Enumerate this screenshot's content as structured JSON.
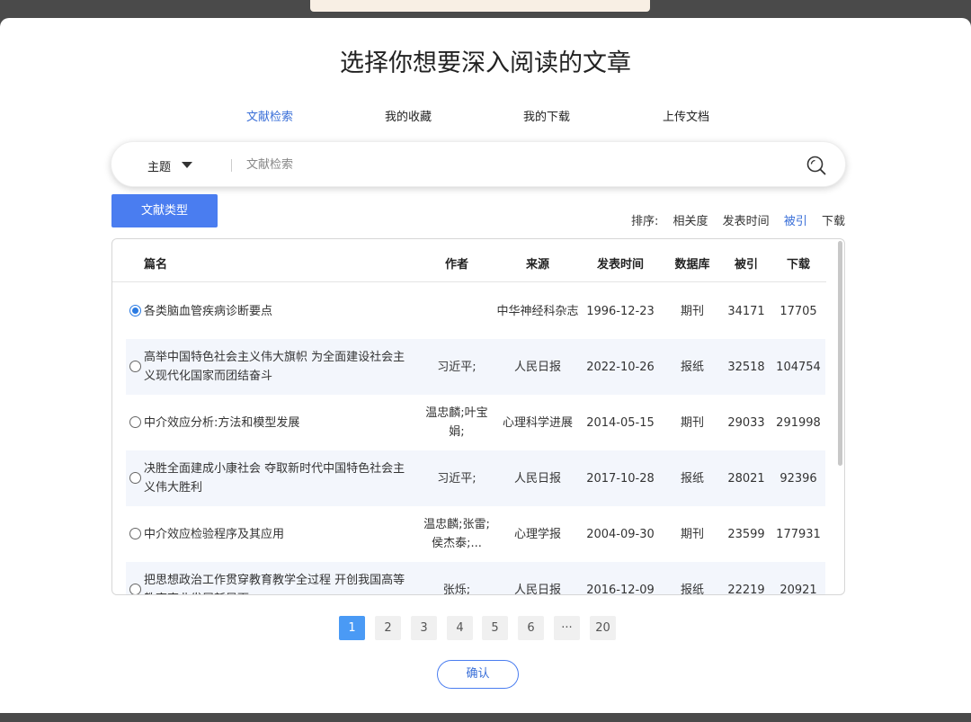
{
  "title": "选择你想要深入阅读的文章",
  "tabs": [
    {
      "label": "文献检索",
      "active": true
    },
    {
      "label": "我的收藏",
      "active": false
    },
    {
      "label": "我的下载",
      "active": false
    },
    {
      "label": "上传文档",
      "active": false
    }
  ],
  "search": {
    "field_label": "主题",
    "placeholder": "文献检索",
    "value": "",
    "icon": "search-icon"
  },
  "type_button": "文献类型",
  "sort": {
    "label": "排序:",
    "options": [
      "相关度",
      "发表时间",
      "被引",
      "下载"
    ],
    "active": "被引"
  },
  "table": {
    "headers": [
      "篇名",
      "作者",
      "来源",
      "发表时间",
      "数据库",
      "被引",
      "下载"
    ],
    "rows": [
      {
        "title": "各类脑血管疾病诊断要点",
        "author": "",
        "source": "中华神经科杂志",
        "date": "1996-12-23",
        "db": "期刊",
        "cited": "34171",
        "downloads": "17705",
        "selected": true
      },
      {
        "title": "高举中国特色社会主义伟大旗帜 为全面建设社会主义现代化国家而团结奋斗",
        "author": "习近平;",
        "source": "人民日报",
        "date": "2022-10-26",
        "db": "报纸",
        "cited": "32518",
        "downloads": "104754",
        "selected": false
      },
      {
        "title": "中介效应分析:方法和模型发展",
        "author": "温忠麟;叶宝娟;",
        "source": "心理科学进展",
        "date": "2014-05-15",
        "db": "期刊",
        "cited": "29033",
        "downloads": "291998",
        "selected": false
      },
      {
        "title": "决胜全面建成小康社会 夺取新时代中国特色社会主义伟大胜利",
        "author": "习近平;",
        "source": "人民日报",
        "date": "2017-10-28",
        "db": "报纸",
        "cited": "28021",
        "downloads": "92396",
        "selected": false
      },
      {
        "title": "中介效应检验程序及其应用",
        "author": "温忠麟;张雷;侯杰泰;...",
        "source": "心理学报",
        "date": "2004-09-30",
        "db": "期刊",
        "cited": "23599",
        "downloads": "177931",
        "selected": false
      },
      {
        "title": "把思想政治工作贯穿教育教学全过程 开创我国高等教育事业发展新局面",
        "author": "张烁;",
        "source": "人民日报",
        "date": "2016-12-09",
        "db": "报纸",
        "cited": "22219",
        "downloads": "20921",
        "selected": false
      }
    ]
  },
  "pagination": {
    "pages": [
      "1",
      "2",
      "3",
      "4",
      "5",
      "6",
      "···",
      "20"
    ],
    "current": "1"
  },
  "confirm_button": "确认"
}
